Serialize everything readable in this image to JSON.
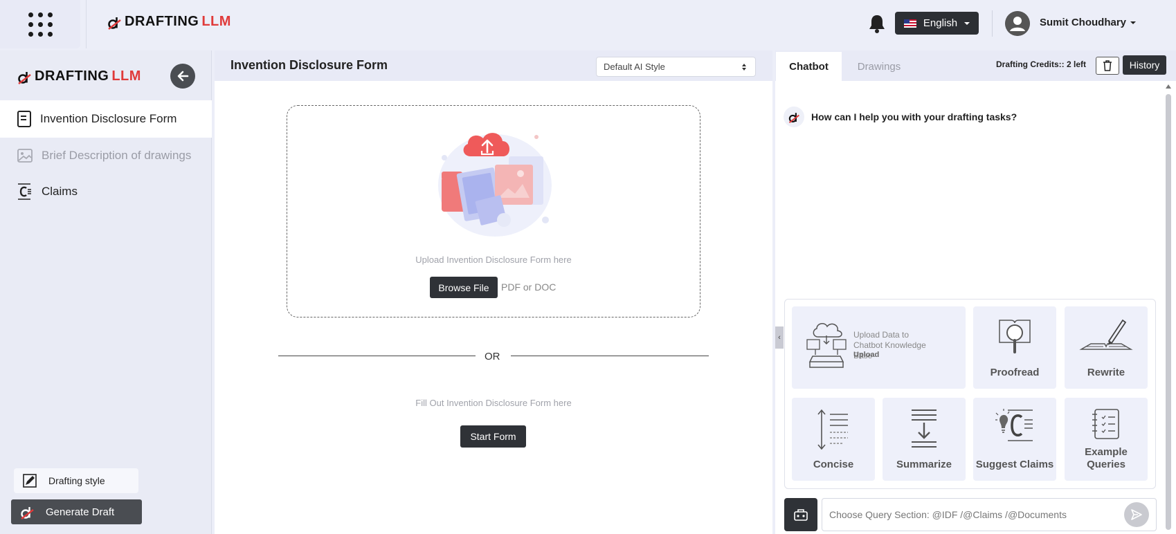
{
  "brand": {
    "word1": "DRAFTING",
    "word2": "LLM",
    "accent_color": "#e03a3a"
  },
  "topbar": {
    "apps_icon": "apps-grid-icon",
    "notifications_icon": "bell-icon",
    "language": {
      "flag": "us-flag-icon",
      "label": "English"
    },
    "user": {
      "name": "Sumit Choudhary",
      "avatar_icon": "user-avatar-icon"
    }
  },
  "sidebar": {
    "back_icon": "arrow-left-icon",
    "items": [
      {
        "label": "Invention Disclosure Form",
        "icon": "document-icon",
        "state": "active"
      },
      {
        "label": "Brief Description of drawings",
        "icon": "image-icon",
        "state": "disabled"
      },
      {
        "label": "Claims",
        "icon": "claims-icon",
        "state": "normal"
      }
    ],
    "drafting_style_label": "Drafting style",
    "generate_label": "Generate Draft"
  },
  "center": {
    "title": "Invention Disclosure Form",
    "style_select": {
      "selected": "Default AI Style"
    },
    "upload": {
      "label": "Upload Invention Disclosure Form here",
      "browse_label": "Browse File",
      "formats": "PDF or DOC"
    },
    "or_text": "OR",
    "fill_label": "Fill Out Invention Disclosure Form here",
    "start_label": "Start Form"
  },
  "right": {
    "tabs": [
      {
        "label": "Chatbot",
        "active": true
      },
      {
        "label": "Drawings",
        "active": false
      }
    ],
    "credits": "Drafting Credits:: 2 left",
    "trash_icon": "trash-icon",
    "history_label": "History",
    "bot_message": "How can I help you with your drafting tasks?",
    "collapse_glyph": "‹",
    "upload_card": {
      "title": "Upload Data to Chatbot Knowledge Base",
      "action": "Upload"
    },
    "tools": [
      {
        "label": "Proofread",
        "icon": "magnify-book-icon"
      },
      {
        "label": "Rewrite",
        "icon": "pen-book-icon"
      },
      {
        "label": "Concise",
        "icon": "concise-lines-icon"
      },
      {
        "label": "Summarize",
        "icon": "summarize-icon"
      },
      {
        "label": "Suggest Claims",
        "icon": "suggest-claims-icon"
      },
      {
        "label": "Example Queries",
        "icon": "example-list-icon"
      }
    ],
    "query": {
      "placeholder": "Choose Query Section: @IDF /@Claims /@Documents",
      "send_icon": "send-icon"
    }
  }
}
